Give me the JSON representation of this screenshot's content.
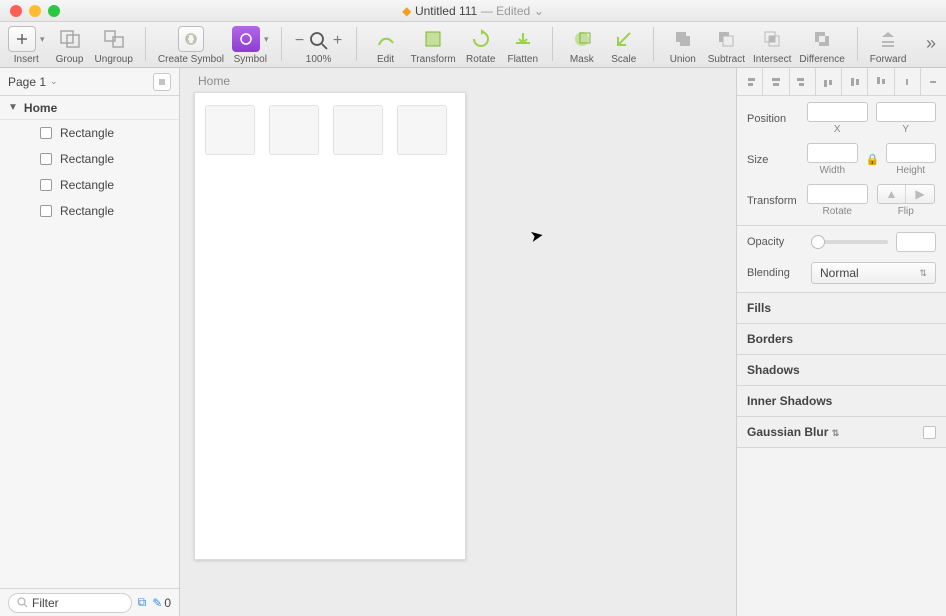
{
  "window": {
    "title_file": "Untitled 111",
    "title_status": "— Edited",
    "dropdown_glyph": "⌄"
  },
  "toolbar": {
    "insert": "Insert",
    "group": "Group",
    "ungroup": "Ungroup",
    "create_symbol": "Create Symbol",
    "symbol": "Symbol",
    "zoom_value": "100%",
    "edit": "Edit",
    "transform": "Transform",
    "rotate": "Rotate",
    "flatten": "Flatten",
    "mask": "Mask",
    "scale": "Scale",
    "union": "Union",
    "subtract": "Subtract",
    "intersect": "Intersect",
    "difference": "Difference",
    "forward": "Forward"
  },
  "sidebar": {
    "page_label": "Page 1",
    "artboard": "Home",
    "layers": [
      {
        "name": "Rectangle"
      },
      {
        "name": "Rectangle"
      },
      {
        "name": "Rectangle"
      },
      {
        "name": "Rectangle"
      }
    ],
    "filter_placeholder": "Filter",
    "slice_count": "0"
  },
  "canvas": {
    "artboard_label": "Home"
  },
  "inspector": {
    "position_label": "Position",
    "x_label": "X",
    "y_label": "Y",
    "size_label": "Size",
    "width_label": "Width",
    "height_label": "Height",
    "transform_label": "Transform",
    "rotate_label": "Rotate",
    "flip_label": "Flip",
    "opacity_label": "Opacity",
    "blending_label": "Blending",
    "blending_value": "Normal",
    "sections": {
      "fills": "Fills",
      "borders": "Borders",
      "shadows": "Shadows",
      "inner_shadows": "Inner Shadows",
      "gaussian_blur": "Gaussian Blur"
    }
  }
}
